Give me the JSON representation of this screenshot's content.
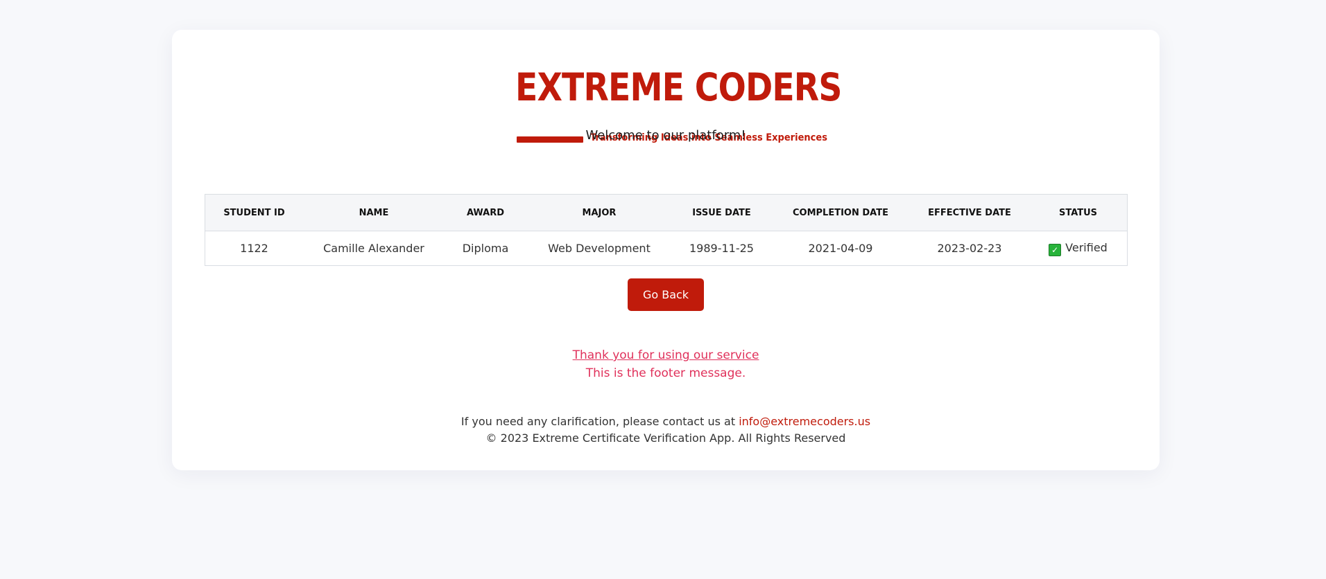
{
  "brand": {
    "name": "EXTREME CODERS",
    "tagline": "Transforming Ideas into Seamless Experiences",
    "color": "#c01b0b"
  },
  "welcome": "Welcome to our platform!",
  "table": {
    "headers": [
      "STUDENT ID",
      "NAME",
      "AWARD",
      "MAJOR",
      "ISSUE DATE",
      "COMPLETION DATE",
      "EFFECTIVE DATE",
      "STATUS"
    ],
    "row": {
      "student_id": "1122",
      "name": "Camille Alexander",
      "award": "Diploma",
      "major": "Web Development",
      "issue_date": "1989-11-25",
      "completion_date": "2021-04-09",
      "effective_date": "2023-02-23",
      "status": "Verified",
      "status_icon": "check-box-icon"
    }
  },
  "actions": {
    "go_back_label": "Go Back"
  },
  "footer": {
    "thanks_link": "Thank you for using our service",
    "message": "This is the footer message.",
    "contact_text": "If you need any clarification, please contact us at",
    "email": "info@extremecoders.us",
    "copyright": "© 2023 Extreme Certificate Verification App. All Rights Reserved",
    "accent_color": "#e0305a"
  }
}
